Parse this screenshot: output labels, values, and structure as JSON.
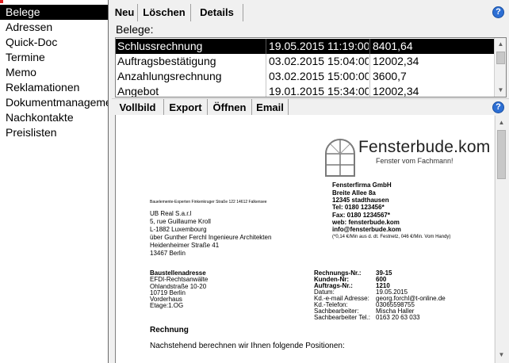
{
  "nav": {
    "items": [
      "Belege",
      "Adressen",
      "Quick-Doc",
      "Termine",
      "Memo",
      "Reklamationen",
      "Dokumentmanagement",
      "Nachkontakte",
      "Preislisten"
    ],
    "selected_index": 0
  },
  "top_toolbar": {
    "new_label": "Neu",
    "delete_label": "Löschen",
    "details_label": "Details"
  },
  "belege": {
    "label": "Belege:",
    "rows": [
      {
        "name": "Schlussrechnung",
        "date": "19.05.2015 11:19:00",
        "amount": "8401,64"
      },
      {
        "name": "Auftragsbestätigung",
        "date": "03.02.2015 15:04:00",
        "amount": "12002,34"
      },
      {
        "name": "Anzahlungsrechnung",
        "date": "03.02.2015 15:00:00",
        "amount": "3600,7"
      },
      {
        "name": "Angebot",
        "date": "19.01.2015 15:34:00",
        "amount": "12002,34"
      }
    ],
    "selected_index": 0
  },
  "preview_toolbar": {
    "fullscreen_label": "Vollbild",
    "export_label": "Export",
    "open_label": "Öffnen",
    "email_label": "Email"
  },
  "help_glyph": "?",
  "document": {
    "logo_name": "Fensterbude.kom",
    "logo_tagline": "Fenster vom Fachmann!",
    "sender_line": "Bauelemente-Experten Finkenkruger Straße 122 14612 Falkensee",
    "recipient": [
      "UB Real S.a.r.l",
      "5, rue Guillaume Kroll",
      "L-1882 Luxembourg",
      "über Gunther Ferchl Ingenieure Architekten",
      "Heidenheimer Straße 41",
      "13467 Berlin"
    ],
    "company_name": "Fensterfirma GmbH",
    "company_lines": [
      "Breite Allee 8a",
      "12345 stadthausen",
      "Tel: 0180 123456*",
      "Fax: 0180 1234567*",
      "web: fensterbude.kom",
      "info@fensterbude.kom"
    ],
    "company_note": "(*0,14 €/Min aus d. dt. Festnetz, 046 €/Min. Vom Handy)",
    "site_title": "Baustellenadresse",
    "site_lines": [
      "EFDI-Rechtsanwälte",
      "Ohlandstraße 10-20",
      "10719 Berlin",
      "Vorderhaus",
      "Etage:1.OG"
    ],
    "info_labels": [
      "Rechnungs-Nr.:",
      "Kunden-Nr:",
      "Auftrags-Nr.:",
      "Datum:",
      "Kd.-e-mail Adresse:",
      "Kd.-Telefon:",
      "Sachbearbeiter:",
      "Sachbearbeiter Tel.:"
    ],
    "info_values": [
      "39-15",
      "600",
      "1210",
      "19.05.2015",
      "georg.forchl@t-online.de",
      "03065598755",
      "Mischa Haller",
      "0163 20 63 033"
    ],
    "heading": "Rechnung",
    "intro": "Nachstehend berechnen wir Ihnen folgende Positionen:"
  },
  "colors": {
    "selection": "#000000",
    "help": "#2d6fd4",
    "accent_corner": "#e02020"
  }
}
